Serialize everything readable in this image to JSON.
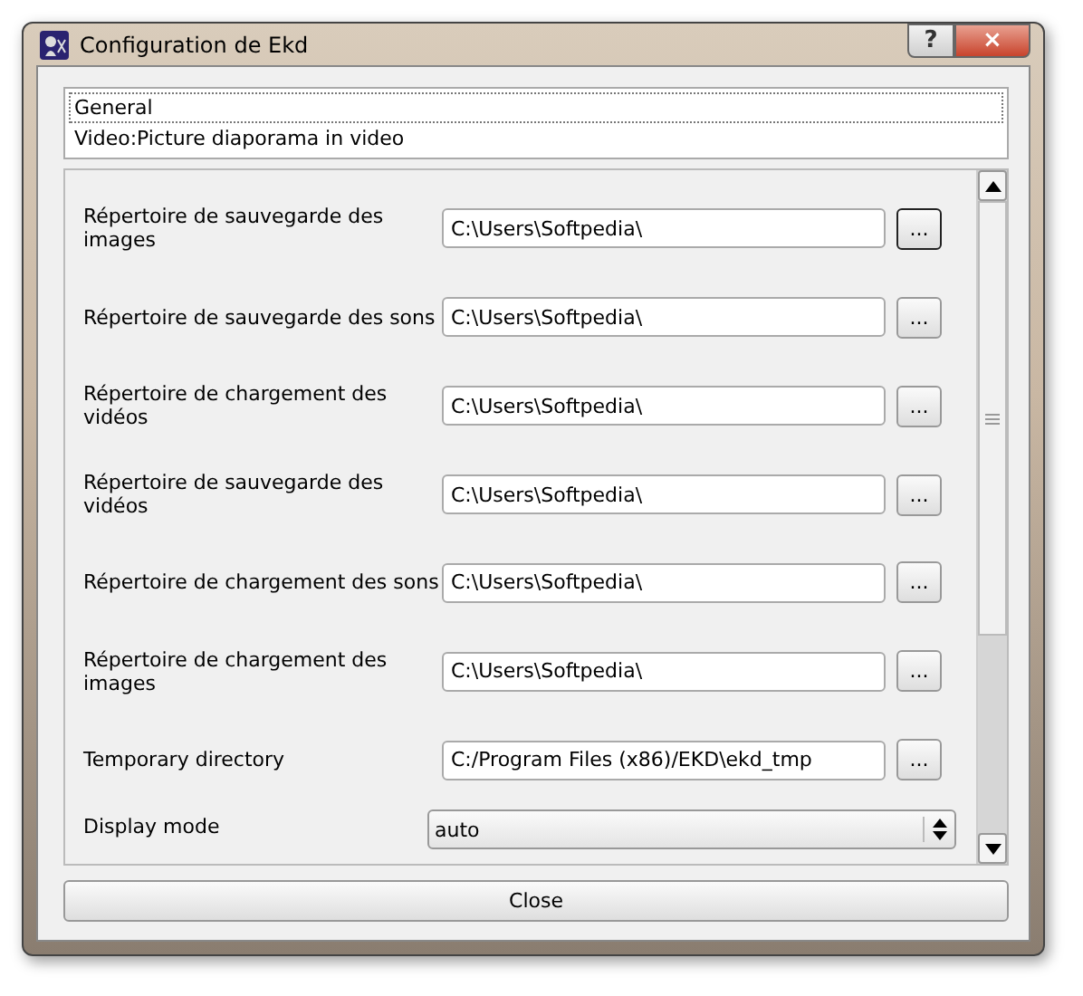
{
  "window": {
    "title": "Configuration de Ekd",
    "buttons": [
      "?",
      "×"
    ]
  },
  "sections": [
    {
      "label": "General",
      "focused": true
    },
    {
      "label": "Video:Picture diaporama in video",
      "focused": false
    }
  ],
  "settings": [
    {
      "kind": "path",
      "label": "Répertoire de sauvegarde des images",
      "value": "C:\\Users\\Softpedia\\",
      "browse": "...",
      "focused": true
    },
    {
      "kind": "path",
      "label": "Répertoire de sauvegarde des sons",
      "value": "C:\\Users\\Softpedia\\",
      "browse": "...",
      "focused": false
    },
    {
      "kind": "path",
      "label": "Répertoire de chargement des vidéos",
      "value": "C:\\Users\\Softpedia\\",
      "browse": "...",
      "focused": false
    },
    {
      "kind": "path",
      "label": "Répertoire de sauvegarde des vidéos",
      "value": "C:\\Users\\Softpedia\\",
      "browse": "...",
      "focused": false
    },
    {
      "kind": "path",
      "label": "Répertoire de chargement des sons",
      "value": "C:\\Users\\Softpedia\\",
      "browse": "...",
      "focused": false
    },
    {
      "kind": "path",
      "label": "Répertoire de chargement des images",
      "value": "C:\\Users\\Softpedia\\",
      "browse": "...",
      "focused": false
    },
    {
      "kind": "path",
      "label": "Temporary directory",
      "value": "C:/Program Files (x86)/EKD\\ekd_tmp",
      "browse": "...",
      "focused": false
    },
    {
      "kind": "select",
      "label": "Display mode",
      "value": "auto"
    }
  ],
  "close_button": "Close"
}
